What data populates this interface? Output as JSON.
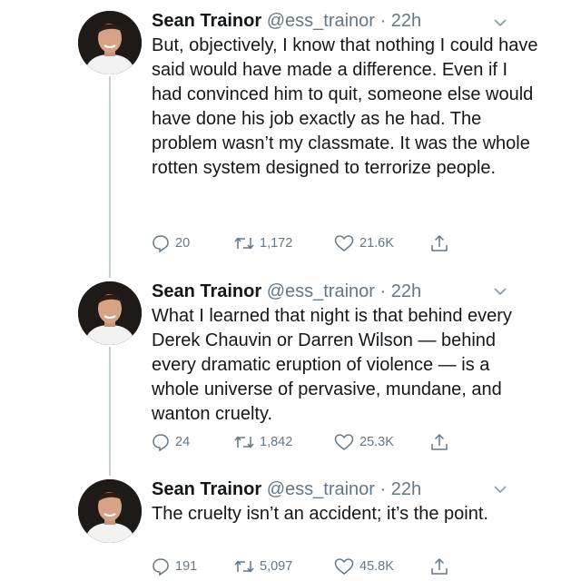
{
  "tweets": [
    {
      "name": "Sean Trainor",
      "handle": "@ess_trainor",
      "separator": "·",
      "time": "22h",
      "text": "But, objectively, I know that nothing I could have said would have made a difference. Even if I had convinced him to quit, someone else would have done his job exactly as he had. The problem wasn’t my classmate. It was the whole rotten system designed to terrorize people.",
      "replies": "20",
      "retweets": "1,172",
      "likes": "21.6K"
    },
    {
      "name": "Sean Trainor",
      "handle": "@ess_trainor",
      "separator": "·",
      "time": "22h",
      "text": "What I learned that night is that behind every Derek Chauvin or Darren Wilson — behind every dramatic eruption of violence — is a whole universe of pervasive, mundane, and wanton cruelty.",
      "replies": "24",
      "retweets": "1,842",
      "likes": "25.3K"
    },
    {
      "name": "Sean Trainor",
      "handle": "@ess_trainor",
      "separator": "·",
      "time": "22h",
      "text": "The cruelty isn’t an accident; it’s the point.",
      "replies": "191",
      "retweets": "5,097",
      "likes": "45.8K"
    }
  ],
  "icons": {
    "reply": "reply-icon",
    "retweet": "retweet-icon",
    "like": "like-icon",
    "share": "share-icon",
    "menu": "chevron-down-icon"
  },
  "colors": {
    "icon_gray": "#657786",
    "thread_line": "#c4cfd6",
    "text": "#14171a"
  }
}
